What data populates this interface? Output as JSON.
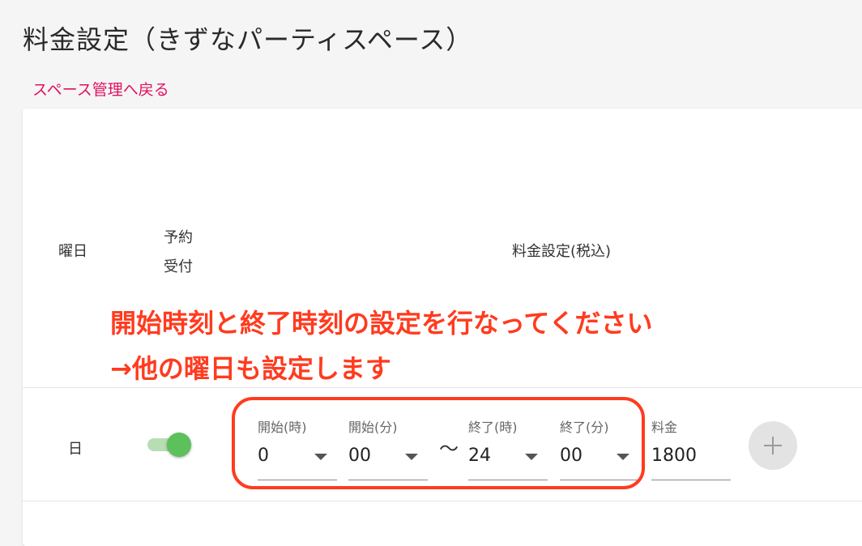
{
  "page_title": "料金設定（きずなパーティスペース）",
  "back_link": "スペース管理へ戻る",
  "table": {
    "headers": {
      "day": "曜日",
      "reserve": "予約受付",
      "price": "料金設定(税込)"
    },
    "row": {
      "day": "日",
      "reserve_enabled": true,
      "start_hour": {
        "label": "開始(時)",
        "value": "0"
      },
      "start_minute": {
        "label": "開始(分)",
        "value": "00"
      },
      "separator": "〜",
      "end_hour": {
        "label": "終了(時)",
        "value": "24"
      },
      "end_minute": {
        "label": "終了(分)",
        "value": "00"
      },
      "price": {
        "label": "料金",
        "value": "1800"
      }
    }
  },
  "annotation": {
    "line1": "開始時刻と終了時刻の設定を行なってください",
    "line2": "→他の曜日も設定します"
  },
  "colors": {
    "accent": "#e0115f",
    "annotation": "#ff3b1f",
    "toggle_on": "#5cc05b"
  },
  "icons": {
    "add_button": "plus-icon",
    "dropdown": "chevron-down-icon"
  }
}
